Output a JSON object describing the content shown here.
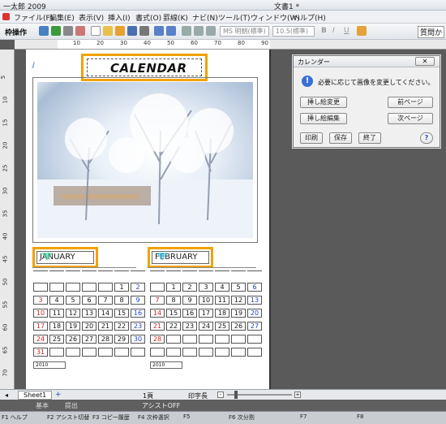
{
  "window": {
    "app_title": "一太郎 2009",
    "doc_title": "文書1 *"
  },
  "menu": [
    "ファイル(F)",
    "編集(E)",
    "表示(V)",
    "挿入(I)",
    "書式(O)",
    "罫線(K)",
    "ナビ(N)",
    "ツール(T)",
    "ウィンドウ(W)",
    "ヘルプ(H)"
  ],
  "toolbar": {
    "frame_op": "枠操作",
    "font_combo": "MS 明朝(標準)",
    "size_combo": "10.5(標準)",
    "quality_btn": "質問か"
  },
  "ruler": {
    "h": [
      "10",
      "20",
      "30",
      "40",
      "50",
      "60",
      "70",
      "80",
      "90"
    ],
    "v": [
      "5",
      "10",
      "15",
      "20",
      "25",
      "30",
      "35",
      "40",
      "45",
      "50",
      "55",
      "60",
      "65",
      "70"
    ]
  },
  "document": {
    "title": "CALENDAR",
    "months": [
      "JANUARY",
      "FEBRUARY"
    ],
    "footer_year": [
      "2010",
      "2010"
    ],
    "january": [
      [
        "",
        "",
        "",
        "",
        "",
        "1",
        "2"
      ],
      [
        "3",
        "4",
        "5",
        "6",
        "7",
        "8",
        "9"
      ],
      [
        "10",
        "11",
        "12",
        "13",
        "14",
        "15",
        "16"
      ],
      [
        "17",
        "18",
        "19",
        "20",
        "21",
        "22",
        "23"
      ],
      [
        "24",
        "25",
        "26",
        "27",
        "28",
        "29",
        "30"
      ],
      [
        "31",
        "",
        "",
        "",
        "",
        "",
        ""
      ]
    ],
    "february": [
      [
        "",
        "1",
        "2",
        "3",
        "4",
        "5",
        "6"
      ],
      [
        "7",
        "8",
        "9",
        "10",
        "11",
        "12",
        "13"
      ],
      [
        "14",
        "15",
        "16",
        "17",
        "18",
        "19",
        "20"
      ],
      [
        "21",
        "22",
        "23",
        "24",
        "25",
        "26",
        "27"
      ],
      [
        "28",
        "",
        "",
        "",
        "",
        "",
        ""
      ],
      [
        "",
        "",
        "",
        "",
        "",
        "",
        ""
      ]
    ]
  },
  "dialog": {
    "title": "カレンダー",
    "message": "必要に応じて画像を変更してください。",
    "buttons": {
      "replace_image": "挿し絵変更",
      "prev_page": "前ページ",
      "edit_image": "挿し絵編集",
      "next_page": "次ページ",
      "print": "印刷",
      "save": "保存",
      "exit": "終了",
      "help": "?"
    }
  },
  "sheetbar": {
    "tab": "Sheet1",
    "page": "1頁",
    "print_len": "印字長"
  },
  "statusbar": {
    "assist": "アシストOFF",
    "basic": "基本",
    "hidden": "提出"
  },
  "fkeys": [
    "F1 ヘルプ",
    "F2 アシスト切替",
    "F3 コピー履歴",
    "F4 次枠選択",
    "F5",
    "F6 次分割",
    "F7",
    "F8"
  ],
  "colors": {
    "accent_orange": "#f2a100",
    "sunday_red": "#d02020",
    "saturday_blue": "#2040c0"
  }
}
